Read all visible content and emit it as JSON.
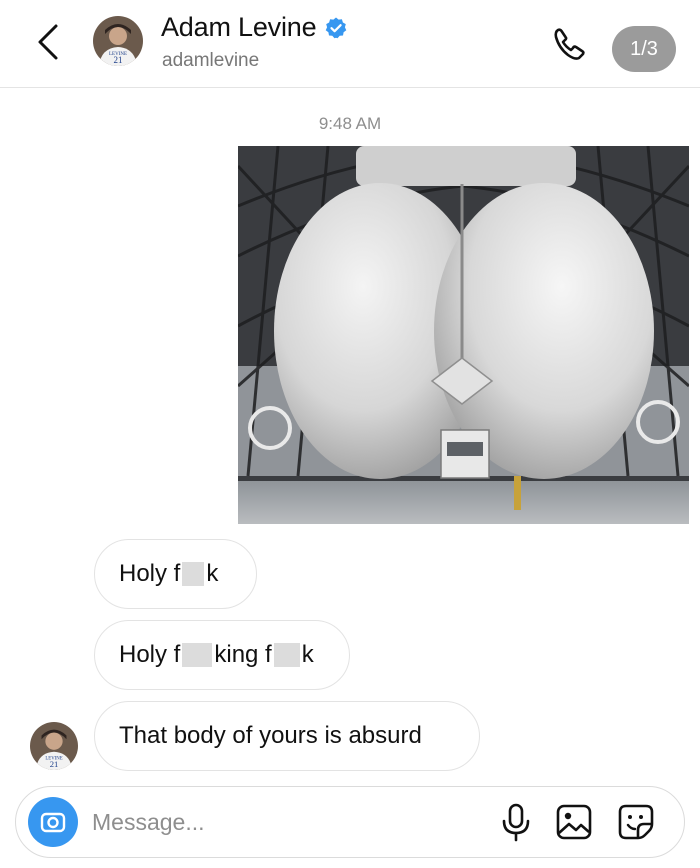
{
  "header": {
    "name": "Adam Levine",
    "username": "adamlevine",
    "counter": "1/3",
    "avatar_jersey_number": "21",
    "avatar_jersey_text": "LEVINE",
    "icons": [
      "back-chevron-icon",
      "verified-badge-icon",
      "phone-icon"
    ]
  },
  "thread": {
    "timestamp": "9:48 AM",
    "messages": [
      {
        "parts": [
          "Holy f",
          "k"
        ]
      },
      {
        "parts": [
          "Holy f",
          "king f",
          "k"
        ]
      },
      {
        "text": "That body of yours is absurd"
      }
    ]
  },
  "composer": {
    "placeholder": "Message...",
    "icons": [
      "camera-icon",
      "microphone-icon",
      "gallery-icon",
      "sticker-icon"
    ]
  },
  "colors": {
    "accent": "#3797f0",
    "verified": "#3797f0",
    "counter_bg": "#9b9b9b",
    "muted_text": "#8e8e8e"
  }
}
